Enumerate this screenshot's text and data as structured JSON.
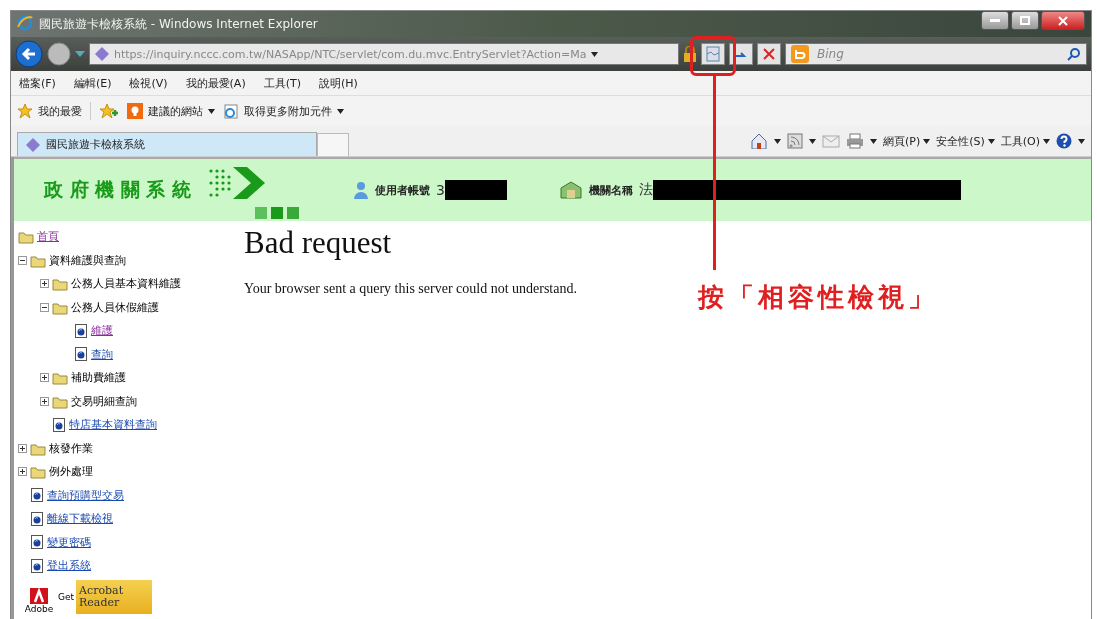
{
  "window": {
    "title": "國民旅遊卡檢核系統 - Windows Internet Explorer"
  },
  "address_bar": {
    "url": "https://inquiry.nccc.com.tw/NASApp/NTC/servlet/com.du.mvc.EntryServlet?Action=Ma"
  },
  "search": {
    "placeholder": "Bing"
  },
  "menu": [
    "檔案(F)",
    "編輯(E)",
    "檢視(V)",
    "我的最愛(A)",
    "工具(T)",
    "說明(H)"
  ],
  "favorites_bar": {
    "favorites": "我的最愛",
    "items": [
      {
        "label": "建議的網站",
        "dropdown": true
      },
      {
        "label": "取得更多附加元件",
        "dropdown": true
      }
    ]
  },
  "tabs": [
    {
      "label": "國民旅遊卡檢核系統",
      "selected": true
    }
  ],
  "command_bar": [
    "網頁(P)",
    "安全性(S)",
    "工具(O)"
  ],
  "site_header": {
    "title": "政 府 機 關 系 統",
    "user_label": "使用者帳號",
    "user_value": "3",
    "org_label": "機關名稱",
    "org_value": "法"
  },
  "tree": [
    {
      "label": "首頁",
      "kind": "root",
      "visited": true
    },
    {
      "label": "資料維護與查詢",
      "kind": "folder",
      "expanded": true,
      "children": [
        {
          "label": "公務人員基本資料維護",
          "kind": "folder",
          "expanded": false
        },
        {
          "label": "公務人員休假維護",
          "kind": "folder",
          "expanded": true,
          "children": [
            {
              "label": "維護",
              "kind": "page",
              "visited": true
            },
            {
              "label": "查詢",
              "kind": "page",
              "visited": false
            }
          ]
        },
        {
          "label": "補助費維護",
          "kind": "folder",
          "expanded": false
        },
        {
          "label": "交易明細查詢",
          "kind": "folder",
          "expanded": false
        },
        {
          "label": "特店基本資料查詢",
          "kind": "page",
          "visited": false
        }
      ]
    },
    {
      "label": "核發作業",
      "kind": "folder",
      "expanded": false
    },
    {
      "label": "例外處理",
      "kind": "folder",
      "expanded": false
    },
    {
      "label": "查詢預購型交易",
      "kind": "page",
      "visited": false
    },
    {
      "label": "離線下載檢視",
      "kind": "page",
      "visited": false
    },
    {
      "label": "變更密碼",
      "kind": "page",
      "visited": false
    },
    {
      "label": "登出系統",
      "kind": "page",
      "visited": false
    }
  ],
  "acrobat_badge": {
    "brand": "Adobe",
    "get": "Get",
    "product": "Acrobat Reader"
  },
  "error": {
    "heading": "Bad request",
    "message": "Your browser sent a query this server could not understand."
  },
  "annotation": {
    "text": "按「相容性檢視」"
  }
}
